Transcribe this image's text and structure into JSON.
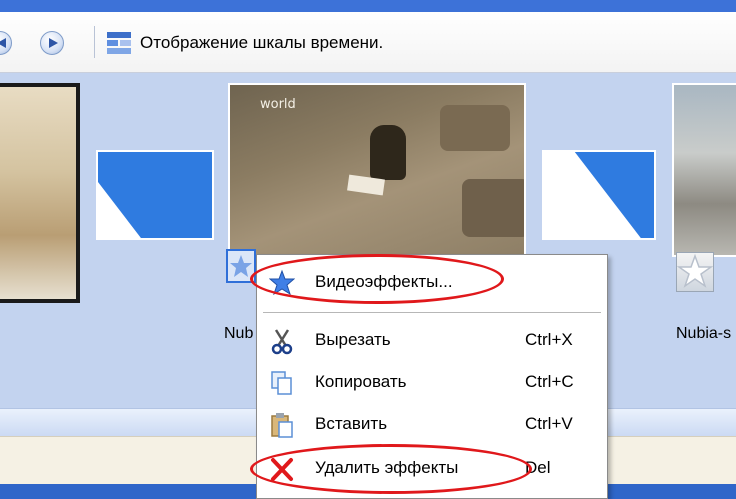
{
  "toolbar": {
    "timeline_label": "Отображение шкалы времени.",
    "timeline_icon": "timeline-grid-icon"
  },
  "storyboard": {
    "clip_mid_caption": "world",
    "clip_mid_name_partial": "Nub",
    "clip_right_name_partial": "Nubia-s"
  },
  "context_menu": {
    "items": [
      {
        "label": "Видеоэффекты...",
        "shortcut": "",
        "icon": "star-effect-icon"
      },
      {
        "label": "Вырезать",
        "shortcut": "Ctrl+X",
        "icon": "scissors-icon"
      },
      {
        "label": "Копировать",
        "shortcut": "Ctrl+C",
        "icon": "copy-icon"
      },
      {
        "label": "Вставить",
        "shortcut": "Ctrl+V",
        "icon": "paste-icon"
      },
      {
        "label": "Удалить эффекты",
        "shortcut": "Del",
        "icon": "delete-x-icon"
      }
    ]
  },
  "colors": {
    "highlight_ring": "#e0181b",
    "accent_blue": "#2f7be0",
    "storyboard_bg": "#c3d3ef"
  }
}
